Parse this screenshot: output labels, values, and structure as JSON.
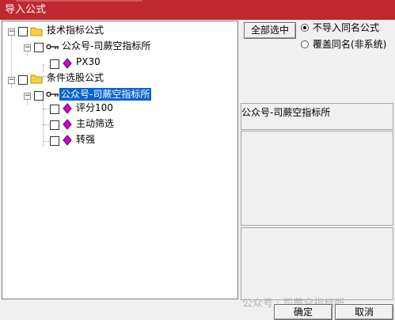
{
  "window": {
    "title": "导入公式"
  },
  "tree": {
    "group1": {
      "label": "技术指标公式",
      "child": {
        "label": "公众号-司蕨空指标所",
        "items": [
          "PX30"
        ]
      }
    },
    "group2": {
      "label": "条件选股公式",
      "child": {
        "label": "公众号-司蕨空指标所",
        "items": [
          "评分100",
          "主动筛选",
          "转强"
        ]
      }
    }
  },
  "buttons": {
    "select_all": "全部选中",
    "ok": "确定",
    "cancel": "取消"
  },
  "options": {
    "skip_same_name": "不导入同名公式",
    "overwrite_same_name": "覆盖同名(非系统)",
    "selected": "skip_same_name"
  },
  "info": {
    "source_name": "公众号-司蕨空指标所"
  },
  "watermark": "公众号 · 司蕨空指标所",
  "colors": {
    "titlebar": "#c0282f",
    "selection": "#0a64d0",
    "formula_icon": "#d400d4",
    "folder": "#f5d23c"
  }
}
